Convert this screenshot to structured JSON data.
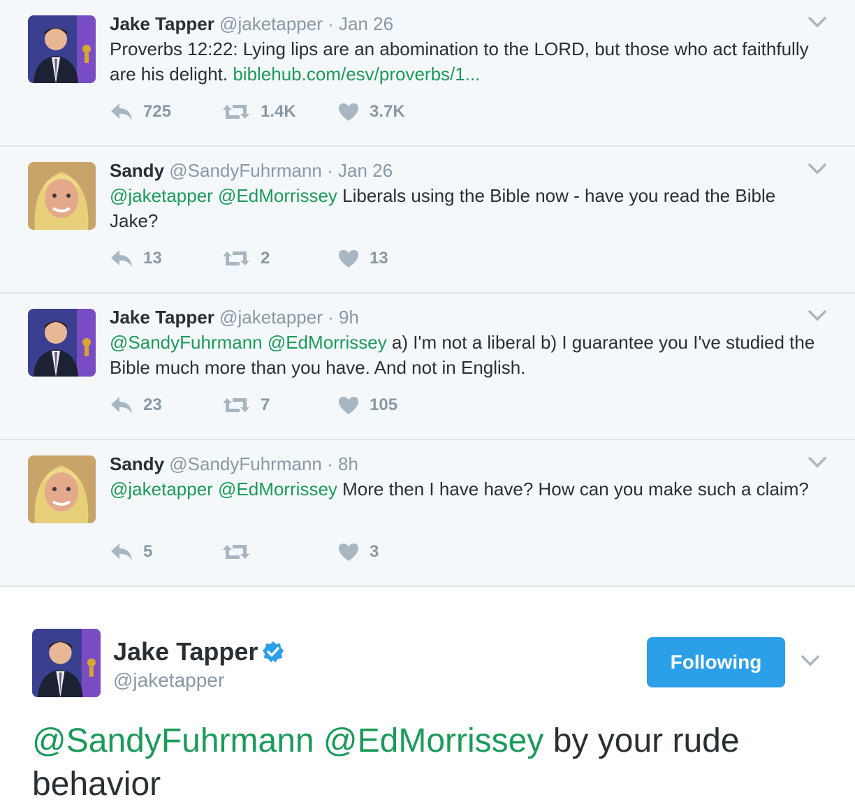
{
  "tweets": [
    {
      "name": "Jake Tapper",
      "handle": "@jaketapper",
      "time": "· Jan 26",
      "text": "Proverbs 12:22: Lying lips are an abomination to the LORD, but those who act faithfully are his delight. ",
      "link": "biblehub.com/esv/proverbs/1...",
      "mentions": "",
      "replies": "725",
      "retweets": "1.4K",
      "likes": "3.7K"
    },
    {
      "name": "Sandy",
      "handle": "@SandyFuhrmann",
      "time": "· Jan 26",
      "mentions": "@jaketapper @EdMorrissey",
      "text": " Liberals using the Bible now - have you read the Bible Jake?",
      "link": "",
      "replies": "13",
      "retweets": "2",
      "likes": "13"
    },
    {
      "name": "Jake Tapper",
      "handle": "@jaketapper",
      "time": "· 9h",
      "mentions": "@SandyFuhrmann @EdMorrissey",
      "text": " a) I'm not a liberal b) I guarantee you I've studied the Bible much more than you have. And not in English.",
      "link": "",
      "replies": "23",
      "retweets": "7",
      "likes": "105"
    },
    {
      "name": "Sandy",
      "handle": "@SandyFuhrmann",
      "time": "· 8h",
      "mentions": "@jaketapper @EdMorrissey",
      "text": " More then I have have? How can you make such a claim?",
      "link": "",
      "replies": "5",
      "retweets": "",
      "likes": "3"
    }
  ],
  "main_tweet": {
    "name": "Jake Tapper",
    "handle": "@jaketapper",
    "follow_label": "Following",
    "mentions": "@SandyFuhrmann @EdMorrissey",
    "text": " by your rude behavior"
  },
  "colors": {
    "link": "#1b9a5a",
    "muted": "#8899a6",
    "follow_button": "#2b9fe8",
    "verified": "#2b9fe8"
  }
}
